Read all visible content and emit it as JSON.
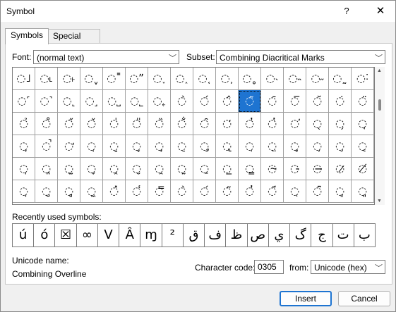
{
  "title": "Symbol",
  "titlebar": {
    "help": "?",
    "close": "✕"
  },
  "tabs": [
    {
      "label": "Symbols"
    },
    {
      "label": "Special Characters"
    }
  ],
  "font": {
    "label": "Font:",
    "value": "(normal text)"
  },
  "subset": {
    "label": "Subset:",
    "value": "Combining Diacritical Marks"
  },
  "grid": {
    "rows": [
      [
        "˩",
        "˪",
        "˫",
        "ˬ",
        "˭",
        "ˮ",
        "˯",
        "˰",
        "˱",
        "˲",
        "˳",
        "˴",
        "˵",
        "˶",
        "˷",
        "˸"
      ],
      [
        "˹",
        "˺",
        "˻",
        "˼",
        "˽",
        "˾",
        "˿",
        "̀",
        "́",
        "̂",
        "̃",
        "̄",
        "̅",
        "̆",
        "̇",
        "̈"
      ],
      [
        "̉",
        "̊",
        "̋",
        "̌",
        "̍",
        "̎",
        "̏",
        "̐",
        "̑",
        "̒",
        "̓",
        "̔",
        "̕",
        "̖",
        "̗",
        "̘"
      ],
      [
        "̙",
        "̚",
        "̛",
        "̜",
        "̝",
        "̞",
        "̟",
        "̠",
        "̡",
        "̢",
        "̣",
        "̤",
        "̥",
        "̦",
        "̧",
        "̨"
      ],
      [
        "̩",
        "̪",
        "̫",
        "̬",
        "̭",
        "̮",
        "̯",
        "̰",
        "̱",
        "̲",
        "̳",
        "̴",
        "̵",
        "̶",
        "̷",
        "̸"
      ],
      [
        "̹",
        "̺",
        "̻",
        "̼",
        "̽",
        "̾",
        "̿",
        "̀",
        "́",
        "͂",
        "̓",
        "̈́",
        "ͅ",
        "͆",
        "͇",
        "͈"
      ]
    ],
    "selected_row": 1,
    "selected_col": 10
  },
  "recent": {
    "label": "Recently used symbols:",
    "symbols": [
      "ú",
      "ó",
      "☒",
      "∞",
      "V",
      "Â",
      "ɱ",
      "²",
      "ق",
      "ف",
      "ظ",
      "ص",
      "ي",
      "گ",
      "ج",
      "ت",
      "ب"
    ]
  },
  "unicode": {
    "label": "Unicode name:",
    "value": "Combining Overline"
  },
  "charcode": {
    "label": "Character code:",
    "value": "0305"
  },
  "from": {
    "label": "from:",
    "value": "Unicode (hex)"
  },
  "buttons": {
    "insert": "Insert",
    "cancel": "Cancel"
  }
}
